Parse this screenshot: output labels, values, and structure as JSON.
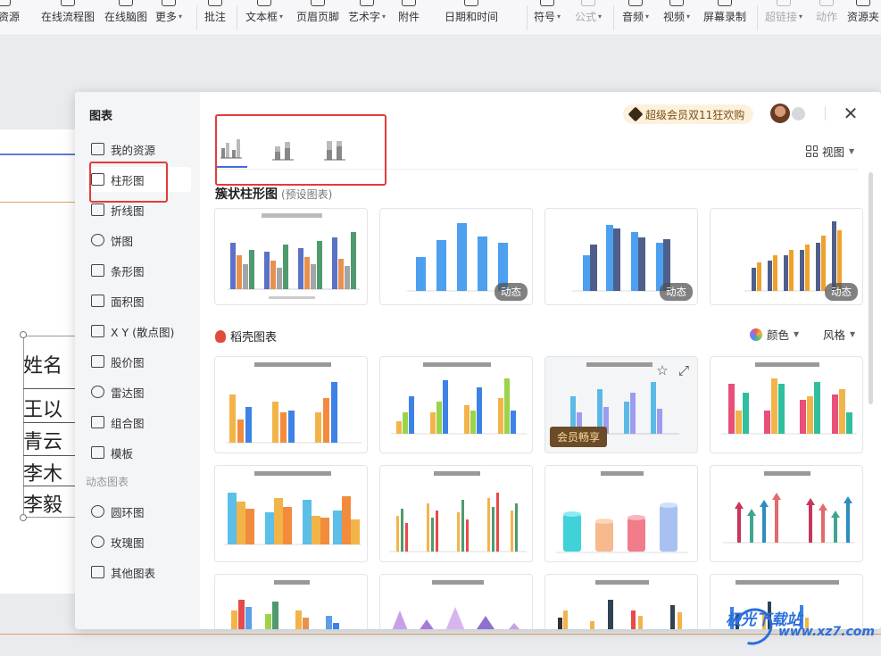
{
  "toolbar": {
    "items": [
      {
        "label": "壳资源",
        "caret": false,
        "disabled": false
      },
      {
        "label": "在线流程图",
        "caret": false,
        "disabled": false
      },
      {
        "label": "在线脑图",
        "caret": false,
        "disabled": false
      },
      {
        "label": "更多",
        "caret": true,
        "disabled": false
      },
      {
        "label": "批注",
        "caret": false,
        "disabled": false
      },
      {
        "label": "文本框",
        "caret": true,
        "disabled": false
      },
      {
        "label": "页眉页脚",
        "caret": false,
        "disabled": false
      },
      {
        "label": "艺术字",
        "caret": true,
        "disabled": false
      },
      {
        "label": "附件",
        "caret": false,
        "disabled": false
      },
      {
        "label": "日期和时间",
        "caret": false,
        "disabled": false
      },
      {
        "label": "符号",
        "caret": true,
        "disabled": false
      },
      {
        "label": "公式",
        "caret": true,
        "disabled": true
      },
      {
        "label": "音频",
        "caret": true,
        "disabled": false
      },
      {
        "label": "视频",
        "caret": true,
        "disabled": false
      },
      {
        "label": "屏幕录制",
        "caret": false,
        "disabled": false
      },
      {
        "label": "超链接",
        "caret": true,
        "disabled": true
      },
      {
        "label": "动作",
        "caret": false,
        "disabled": true
      },
      {
        "label": "资源夹",
        "caret": false,
        "disabled": false
      }
    ]
  },
  "document": {
    "table_cells": [
      "姓名",
      "王以",
      "青云",
      "李木",
      "李毅"
    ]
  },
  "dialog": {
    "title": "图表",
    "sidebar": {
      "items": [
        {
          "label": "我的资源",
          "icon": "user-icon"
        },
        {
          "label": "柱形图",
          "icon": "bar-chart-icon"
        },
        {
          "label": "折线图",
          "icon": "line-chart-icon"
        },
        {
          "label": "饼图",
          "icon": "pie-chart-icon"
        },
        {
          "label": "条形图",
          "icon": "horizontal-bar-icon"
        },
        {
          "label": "面积图",
          "icon": "area-chart-icon"
        },
        {
          "label": "X Y (散点图)",
          "icon": "scatter-icon"
        },
        {
          "label": "股价图",
          "icon": "stock-chart-icon"
        },
        {
          "label": "雷达图",
          "icon": "radar-chart-icon"
        },
        {
          "label": "组合图",
          "icon": "combo-chart-icon"
        },
        {
          "label": "模板",
          "icon": "template-icon"
        }
      ],
      "section_dynamic": "动态图表",
      "dynamic_items": [
        {
          "label": "圆环图",
          "icon": "donut-chart-icon"
        },
        {
          "label": "玫瑰图",
          "icon": "rose-chart-icon"
        },
        {
          "label": "其他图表",
          "icon": "other-chart-icon"
        }
      ]
    },
    "promo": "超级会员双11狂欢购",
    "view_label": "视图",
    "section_preset": "簇状柱形图",
    "section_preset_sub": "(预设图表)",
    "section_store": "稻壳图表",
    "color_label": "颜色",
    "style_label": "风格",
    "badge_dynamic": "动态",
    "badge_vip": "会员畅享"
  },
  "colors": {
    "accent": "#3e6be0",
    "highlight_red": "#e23b3b",
    "vip_brown": "#6a4c28"
  },
  "watermark": {
    "brand": "极光下载站",
    "url": "www.xz7.com"
  }
}
